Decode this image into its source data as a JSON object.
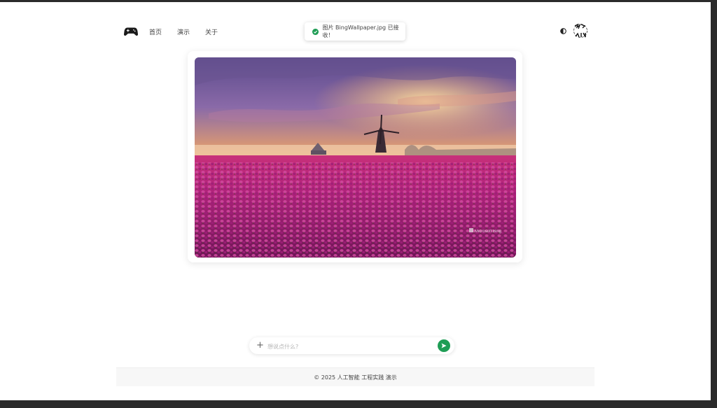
{
  "header": {
    "logo_icon": "gamepad-icon",
    "nav": [
      {
        "label": "首页"
      },
      {
        "label": "演示"
      },
      {
        "label": "关于"
      }
    ],
    "theme_icon": "half-circle-theme-icon",
    "avatar_text": "AKI"
  },
  "toast": {
    "icon": "check-circle-icon",
    "message": "图片 BingWallpaper.jpg 已接收！",
    "color": "#1f9d55"
  },
  "image_card": {
    "image": "tulip-field-windmill-sunset",
    "watermark": "Microsoft Bing"
  },
  "chat": {
    "plus_label": "+",
    "placeholder": "想说点什么?",
    "value": "",
    "send_icon": "send-arrow-icon",
    "accent": "#1f9d55"
  },
  "footer": {
    "text": "© 2025 人工智能 工程实践 演示"
  }
}
